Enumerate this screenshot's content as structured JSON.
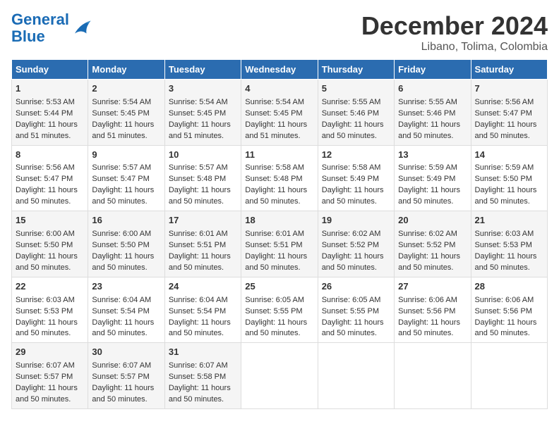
{
  "logo": {
    "line1": "General",
    "line2": "Blue"
  },
  "title": "December 2024",
  "subtitle": "Libano, Tolima, Colombia",
  "days_of_week": [
    "Sunday",
    "Monday",
    "Tuesday",
    "Wednesday",
    "Thursday",
    "Friday",
    "Saturday"
  ],
  "weeks": [
    [
      {
        "day": "1",
        "sunrise": "5:53 AM",
        "sunset": "5:44 PM",
        "daylight": "11 hours and 51 minutes."
      },
      {
        "day": "2",
        "sunrise": "5:54 AM",
        "sunset": "5:45 PM",
        "daylight": "11 hours and 51 minutes."
      },
      {
        "day": "3",
        "sunrise": "5:54 AM",
        "sunset": "5:45 PM",
        "daylight": "11 hours and 51 minutes."
      },
      {
        "day": "4",
        "sunrise": "5:54 AM",
        "sunset": "5:45 PM",
        "daylight": "11 hours and 51 minutes."
      },
      {
        "day": "5",
        "sunrise": "5:55 AM",
        "sunset": "5:46 PM",
        "daylight": "11 hours and 50 minutes."
      },
      {
        "day": "6",
        "sunrise": "5:55 AM",
        "sunset": "5:46 PM",
        "daylight": "11 hours and 50 minutes."
      },
      {
        "day": "7",
        "sunrise": "5:56 AM",
        "sunset": "5:47 PM",
        "daylight": "11 hours and 50 minutes."
      }
    ],
    [
      {
        "day": "8",
        "sunrise": "5:56 AM",
        "sunset": "5:47 PM",
        "daylight": "11 hours and 50 minutes."
      },
      {
        "day": "9",
        "sunrise": "5:57 AM",
        "sunset": "5:47 PM",
        "daylight": "11 hours and 50 minutes."
      },
      {
        "day": "10",
        "sunrise": "5:57 AM",
        "sunset": "5:48 PM",
        "daylight": "11 hours and 50 minutes."
      },
      {
        "day": "11",
        "sunrise": "5:58 AM",
        "sunset": "5:48 PM",
        "daylight": "11 hours and 50 minutes."
      },
      {
        "day": "12",
        "sunrise": "5:58 AM",
        "sunset": "5:49 PM",
        "daylight": "11 hours and 50 minutes."
      },
      {
        "day": "13",
        "sunrise": "5:59 AM",
        "sunset": "5:49 PM",
        "daylight": "11 hours and 50 minutes."
      },
      {
        "day": "14",
        "sunrise": "5:59 AM",
        "sunset": "5:50 PM",
        "daylight": "11 hours and 50 minutes."
      }
    ],
    [
      {
        "day": "15",
        "sunrise": "6:00 AM",
        "sunset": "5:50 PM",
        "daylight": "11 hours and 50 minutes."
      },
      {
        "day": "16",
        "sunrise": "6:00 AM",
        "sunset": "5:50 PM",
        "daylight": "11 hours and 50 minutes."
      },
      {
        "day": "17",
        "sunrise": "6:01 AM",
        "sunset": "5:51 PM",
        "daylight": "11 hours and 50 minutes."
      },
      {
        "day": "18",
        "sunrise": "6:01 AM",
        "sunset": "5:51 PM",
        "daylight": "11 hours and 50 minutes."
      },
      {
        "day": "19",
        "sunrise": "6:02 AM",
        "sunset": "5:52 PM",
        "daylight": "11 hours and 50 minutes."
      },
      {
        "day": "20",
        "sunrise": "6:02 AM",
        "sunset": "5:52 PM",
        "daylight": "11 hours and 50 minutes."
      },
      {
        "day": "21",
        "sunrise": "6:03 AM",
        "sunset": "5:53 PM",
        "daylight": "11 hours and 50 minutes."
      }
    ],
    [
      {
        "day": "22",
        "sunrise": "6:03 AM",
        "sunset": "5:53 PM",
        "daylight": "11 hours and 50 minutes."
      },
      {
        "day": "23",
        "sunrise": "6:04 AM",
        "sunset": "5:54 PM",
        "daylight": "11 hours and 50 minutes."
      },
      {
        "day": "24",
        "sunrise": "6:04 AM",
        "sunset": "5:54 PM",
        "daylight": "11 hours and 50 minutes."
      },
      {
        "day": "25",
        "sunrise": "6:05 AM",
        "sunset": "5:55 PM",
        "daylight": "11 hours and 50 minutes."
      },
      {
        "day": "26",
        "sunrise": "6:05 AM",
        "sunset": "5:55 PM",
        "daylight": "11 hours and 50 minutes."
      },
      {
        "day": "27",
        "sunrise": "6:06 AM",
        "sunset": "5:56 PM",
        "daylight": "11 hours and 50 minutes."
      },
      {
        "day": "28",
        "sunrise": "6:06 AM",
        "sunset": "5:56 PM",
        "daylight": "11 hours and 50 minutes."
      }
    ],
    [
      {
        "day": "29",
        "sunrise": "6:07 AM",
        "sunset": "5:57 PM",
        "daylight": "11 hours and 50 minutes."
      },
      {
        "day": "30",
        "sunrise": "6:07 AM",
        "sunset": "5:57 PM",
        "daylight": "11 hours and 50 minutes."
      },
      {
        "day": "31",
        "sunrise": "6:07 AM",
        "sunset": "5:58 PM",
        "daylight": "11 hours and 50 minutes."
      },
      null,
      null,
      null,
      null
    ]
  ],
  "labels": {
    "sunrise": "Sunrise:",
    "sunset": "Sunset:",
    "daylight": "Daylight:"
  }
}
